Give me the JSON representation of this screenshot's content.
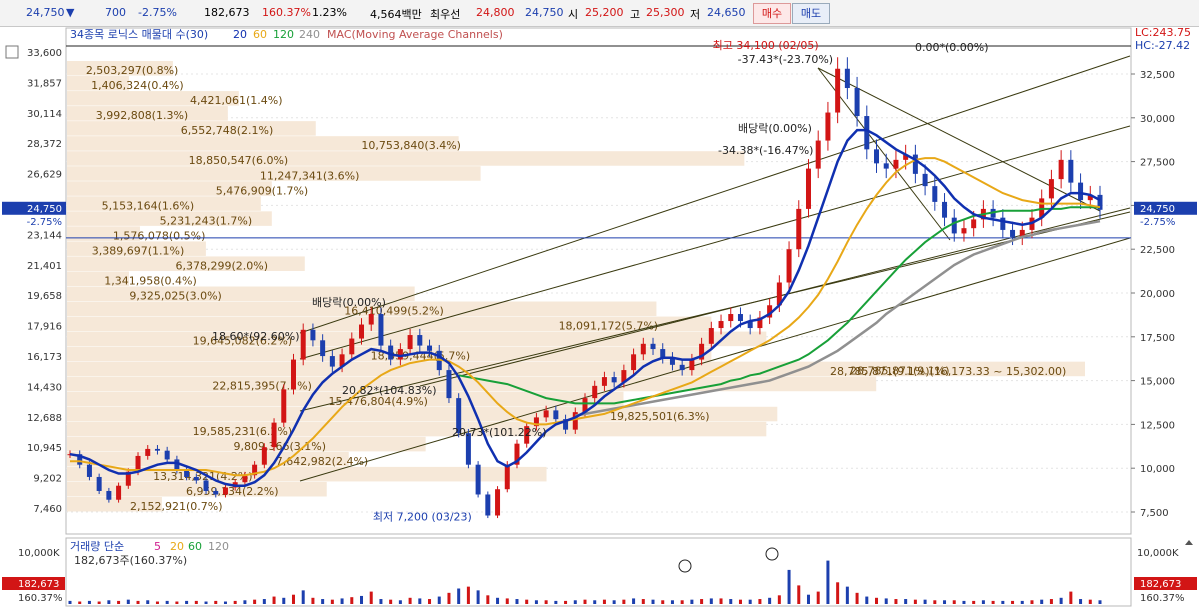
{
  "topbar": {
    "price": "24,750",
    "arrow": "▼",
    "change": "700",
    "change_pct": "-2.75%",
    "volume": "182,673",
    "volume_ratio": "160.37%",
    "turnover": "1.23%",
    "amount": "4,564백만",
    "best_bid_label": "최우선",
    "best_ask": "24,800",
    "best_bid": "24,750",
    "open_label": "시",
    "open": "25,200",
    "high_label": "고",
    "high": "25,300",
    "low_label": "저",
    "low": "24,650",
    "buy_label": "매수",
    "sell_label": "매도"
  },
  "legend": {
    "title": "34종목 로닉스 매물대 수(30)",
    "ma": [
      "20",
      "60",
      "120",
      "240"
    ],
    "mac": "MAC(Moving Average Channels)",
    "lc": "LC:243.75",
    "hc": "HC:-27.42"
  },
  "y_axis_left": {
    "ticks": [
      "33,600",
      "31,857",
      "30,114",
      "28,372",
      "26,629",
      "24,750",
      "23,144",
      "21,401",
      "19,658",
      "17,916",
      "16,173",
      "14,430",
      "12,688",
      "10,945",
      "9,202",
      "7,460"
    ],
    "current": "24,750",
    "current_pct": "-2.75%"
  },
  "y_axis_right": {
    "ticks": [
      "32,500",
      "30,000",
      "27,500",
      "25,000",
      "22,500",
      "20,000",
      "17,500",
      "15,000",
      "12,500",
      "10,000",
      "7,500"
    ],
    "current": "24,750",
    "current_pct": "-2.75%"
  },
  "annotations": {
    "high": "최고 34,100 (02/05)",
    "high_sub": "-37.43*(-23.70%)",
    "low": "최저 7,200 (03/23)",
    "zero": "0.00*(0.00%)",
    "dividend1": "배당락(0.00%)",
    "dividend1_sub": "-34.38*(-16.47%)",
    "dividend2": "배당락(0.00%)",
    "angle1": "18.60*(92.60%)",
    "angle2": "20.82*(104.83%)",
    "angle3": "20.73*(101.22%)",
    "range_label": "28,785,871(9.1%)(16,173.33 ~ 15,302.00)"
  },
  "volume_profile": [
    {
      "label": "2,503,297(0.8%)",
      "pct": 0.8
    },
    {
      "label": "1,406,324(0.4%)",
      "pct": 0.4
    },
    {
      "label": "4,421,061(1.4%)",
      "pct": 1.4
    },
    {
      "label": "3,992,808(1.3%)",
      "pct": 1.3
    },
    {
      "label": "6,552,748(2.1%)",
      "pct": 2.1
    },
    {
      "label": "10,753,840(3.4%)",
      "pct": 3.4
    },
    {
      "label": "18,850,547(6.0%)",
      "pct": 6.0
    },
    {
      "label": "11,247,341(3.6%)",
      "pct": 3.6
    },
    {
      "label": "5,476,909(1.7%)",
      "pct": 1.7
    },
    {
      "label": "5,153,164(1.6%)",
      "pct": 1.6
    },
    {
      "label": "5,231,243(1.7%)",
      "pct": 1.7
    },
    {
      "label": "1,576,078(0.5%)",
      "pct": 0.5
    },
    {
      "label": "3,389,697(1.1%)",
      "pct": 1.1
    },
    {
      "label": "6,378,299(2.0%)",
      "pct": 2.0
    },
    {
      "label": "1,341,958(0.4%)",
      "pct": 0.4
    },
    {
      "label": "9,325,025(3.0%)",
      "pct": 3.0
    },
    {
      "label": "16,410,499(5.2%)",
      "pct": 5.2
    },
    {
      "label": "18,091,172(5.7%)",
      "pct": 5.7
    },
    {
      "label": "19,645,082(6.2%)",
      "pct": 6.2
    },
    {
      "label": "18,059,444(5.7%)",
      "pct": 5.7
    },
    {
      "label": "28,785,871(9.1%)",
      "pct": 9.1
    },
    {
      "label": "22,815,395(7.2%)",
      "pct": 7.2
    },
    {
      "label": "15,476,804(4.9%)",
      "pct": 4.9
    },
    {
      "label": "19,825,501(6.3%)",
      "pct": 6.3
    },
    {
      "label": "19,585,231(6.2%)",
      "pct": 6.2
    },
    {
      "label": "9,809,366(3.1%)",
      "pct": 3.1
    },
    {
      "label": "7,642,982(2.4%)",
      "pct": 2.4
    },
    {
      "label": "13,314,321(4.2%)",
      "pct": 4.2
    },
    {
      "label": "6,959,134(2.2%)",
      "pct": 2.2
    },
    {
      "label": "2,152,921(0.7%)",
      "pct": 0.7
    }
  ],
  "volume_panel": {
    "legend": "거래량 단순",
    "ma": [
      "5",
      "20",
      "60",
      "120"
    ],
    "sub": "182,673주(160.37%)",
    "left_top": "10,000K",
    "right_top": "10,000K",
    "current": "182,673",
    "current_pct": "160.37%"
  },
  "colors": {
    "ma20": "#1030b0",
    "ma60": "#e8a817",
    "ma120": "#18a038",
    "ma240": "#909090",
    "profile": "#f6e8d8",
    "profile_text": "#6b4a10",
    "up": "#d21515",
    "down": "#1c3fae"
  },
  "chart_data": {
    "type": "line",
    "title": "",
    "ylim": [
      7200,
      34100
    ],
    "price_high": 34100,
    "price_low": 7200,
    "current_price": 24750,
    "ma_periods": [
      20,
      60,
      120,
      240
    ],
    "price_path": [
      10800,
      10200,
      9500,
      8700,
      8200,
      9000,
      9800,
      10700,
      11100,
      11000,
      10500,
      9900,
      9500,
      9300,
      8700,
      8500,
      8900,
      9200,
      9600,
      10200,
      11200,
      12600,
      14500,
      16200,
      17900,
      17300,
      16400,
      15800,
      16500,
      17400,
      18200,
      18800,
      17000,
      16200,
      16800,
      17600,
      17000,
      16700,
      15600,
      14000,
      12000,
      10200,
      8500,
      7300,
      8800,
      10200,
      11400,
      12400,
      12900,
      13300,
      12800,
      12200,
      13200,
      14000,
      14700,
      15200,
      14900,
      15600,
      16500,
      17100,
      16800,
      16300,
      15900,
      15600,
      16200,
      17100,
      18000,
      18400,
      18800,
      18400,
      18000,
      18600,
      19300,
      20600,
      22500,
      24800,
      27100,
      28700,
      30300,
      32800,
      31700,
      30100,
      28200,
      27400,
      27100,
      27600,
      27900,
      26800,
      26100,
      25200,
      24300,
      23400,
      23700,
      24200,
      24800,
      24300,
      23600,
      23200,
      23600,
      24300,
      25400,
      26500,
      27600,
      26300,
      25300,
      25600,
      24750
    ],
    "ma20_path": [
      10800,
      10700,
      10500,
      10200,
      9900,
      9700,
      9700,
      9800,
      10000,
      10200,
      10300,
      10300,
      10100,
      9900,
      9600,
      9300,
      9100,
      9000,
      9000,
      9200,
      9600,
      10300,
      11200,
      12200,
      13300,
      14200,
      14900,
      15400,
      15800,
      16200,
      16500,
      16800,
      16700,
      16500,
      16400,
      16500,
      16600,
      16600,
      16400,
      16000,
      15200,
      14100,
      12800,
      11400,
      10400,
      10100,
      10400,
      10900,
      11500,
      12100,
      12500,
      12700,
      12900,
      13200,
      13600,
      14100,
      14500,
      14900,
      15300,
      15800,
      16100,
      16300,
      16300,
      16200,
      16200,
      16400,
      16800,
      17300,
      17800,
      18200,
      18400,
      18500,
      18800,
      19300,
      20100,
      21300,
      22700,
      24300,
      25900,
      27500,
      28700,
      29300,
      29300,
      29000,
      28600,
      28200,
      27900,
      27600,
      27200,
      26700,
      26100,
      25400,
      24900,
      24500,
      24300,
      24200,
      24100,
      24000,
      23900,
      24000,
      24300,
      24800,
      25400,
      25700,
      25700,
      25600,
      25300
    ],
    "ma60_path": [
      10400,
      10400,
      10300,
      10200,
      10100,
      10000,
      9900,
      9900,
      9900,
      9900,
      9900,
      9900,
      9900,
      9900,
      9900,
      9800,
      9700,
      9600,
      9600,
      9700,
      9800,
      10000,
      10300,
      10700,
      11200,
      11700,
      12300,
      12900,
      13500,
      14000,
      14500,
      14900,
      15300,
      15600,
      15800,
      16000,
      16100,
      16200,
      16200,
      16100,
      15800,
      15400,
      14900,
      14300,
      13700,
      13200,
      12800,
      12600,
      12500,
      12500,
      12600,
      12700,
      12800,
      12900,
      13000,
      13100,
      13300,
      13500,
      13700,
      13900,
      14100,
      14300,
      14500,
      14700,
      14900,
      15200,
      15500,
      15800,
      16100,
      16400,
      16700,
      17000,
      17300,
      17700,
      18100,
      18600,
      19200,
      19900,
      20800,
      21800,
      22900,
      23900,
      24800,
      25600,
      26300,
      26900,
      27300,
      27600,
      27700,
      27700,
      27500,
      27200,
      26900,
      26600,
      26300,
      26000,
      25700,
      25500,
      25300,
      25200,
      25100,
      25100,
      25100,
      25100,
      25100,
      25000,
      24900
    ],
    "ma120_path": [
      null,
      null,
      null,
      null,
      null,
      null,
      null,
      null,
      null,
      null,
      null,
      null,
      null,
      null,
      null,
      null,
      null,
      null,
      null,
      null,
      null,
      null,
      null,
      null,
      null,
      null,
      null,
      null,
      null,
      null,
      null,
      null,
      null,
      null,
      null,
      null,
      null,
      null,
      null,
      null,
      15300,
      15200,
      15100,
      15000,
      14900,
      14800,
      14600,
      14400,
      14200,
      14000,
      13900,
      13800,
      13700,
      13700,
      13700,
      13700,
      13700,
      13800,
      13900,
      14000,
      14100,
      14200,
      14300,
      14400,
      14500,
      14600,
      14700,
      14800,
      15000,
      15100,
      15300,
      15400,
      15600,
      15800,
      16000,
      16200,
      16500,
      16900,
      17300,
      17800,
      18300,
      18900,
      19500,
      20100,
      20700,
      21300,
      21900,
      22400,
      22900,
      23300,
      23700,
      24000,
      24200,
      24400,
      24500,
      24600,
      24700,
      24700,
      24700,
      24700,
      24800,
      24800,
      24800,
      24900,
      24900,
      24900,
      24900
    ],
    "ma240_path": [
      null,
      null,
      null,
      null,
      null,
      null,
      null,
      null,
      null,
      null,
      null,
      null,
      null,
      null,
      null,
      null,
      null,
      null,
      null,
      null,
      null,
      null,
      null,
      null,
      null,
      null,
      null,
      null,
      null,
      null,
      null,
      null,
      null,
      null,
      null,
      null,
      null,
      null,
      null,
      null,
      null,
      null,
      null,
      null,
      null,
      null,
      null,
      null,
      null,
      null,
      null,
      null,
      13000,
      13100,
      13200,
      13300,
      13400,
      13500,
      13600,
      13700,
      13800,
      13900,
      14000,
      14100,
      14200,
      14300,
      14400,
      14500,
      14600,
      14700,
      14800,
      14900,
      15000,
      15200,
      15400,
      15600,
      15800,
      16100,
      16400,
      16700,
      17100,
      17500,
      17900,
      18300,
      18800,
      19200,
      19600,
      20000,
      20400,
      20800,
      21200,
      21600,
      21900,
      22200,
      22400,
      22600,
      22800,
      23000,
      23200,
      23300,
      23500,
      23600,
      23700,
      23800,
      23900,
      24000,
      24100
    ],
    "volume_spikes": [
      0.05,
      0.04,
      0.05,
      0.04,
      0.06,
      0.05,
      0.07,
      0.05,
      0.06,
      0.04,
      0.05,
      0.04,
      0.05,
      0.05,
      0.04,
      0.05,
      0.04,
      0.05,
      0.06,
      0.07,
      0.08,
      0.12,
      0.1,
      0.15,
      0.22,
      0.1,
      0.08,
      0.07,
      0.09,
      0.11,
      0.13,
      0.2,
      0.08,
      0.07,
      0.06,
      0.1,
      0.09,
      0.08,
      0.12,
      0.18,
      0.25,
      0.28,
      0.22,
      0.14,
      0.1,
      0.09,
      0.08,
      0.07,
      0.06,
      0.06,
      0.05,
      0.05,
      0.06,
      0.07,
      0.06,
      0.07,
      0.06,
      0.07,
      0.09,
      0.08,
      0.07,
      0.06,
      0.06,
      0.06,
      0.07,
      0.08,
      0.09,
      0.09,
      0.08,
      0.07,
      0.07,
      0.08,
      0.1,
      0.14,
      0.55,
      0.3,
      0.15,
      0.2,
      0.7,
      0.35,
      0.28,
      0.18,
      0.12,
      0.1,
      0.09,
      0.08,
      0.08,
      0.07,
      0.07,
      0.06,
      0.06,
      0.06,
      0.05,
      0.05,
      0.06,
      0.05,
      0.05,
      0.05,
      0.05,
      0.06,
      0.07,
      0.08,
      0.1,
      0.2,
      0.08,
      0.07,
      0.06
    ]
  }
}
